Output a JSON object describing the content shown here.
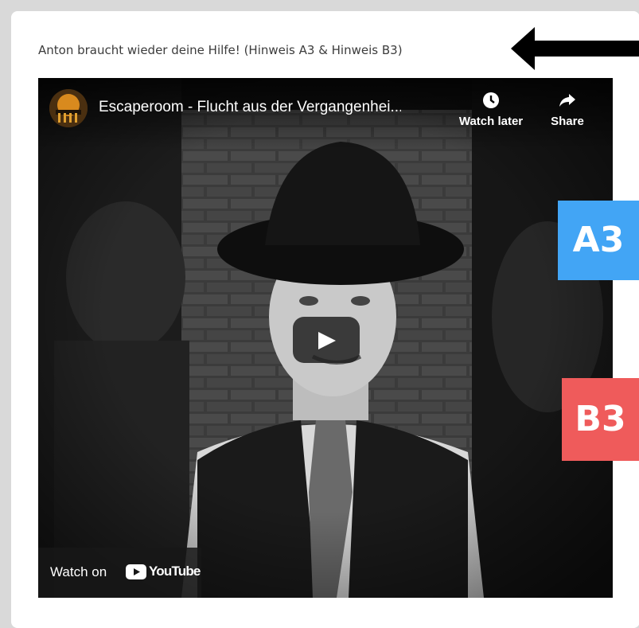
{
  "caption": "Anton braucht wieder deine Hilfe! (Hinweis A3 & Hinweis B3)",
  "video": {
    "title": "Escaperoom - Flucht aus der Vergangenhei...",
    "watch_later_label": "Watch later",
    "share_label": "Share",
    "watch_on_label": "Watch on",
    "youtube_wordmark": "YouTube"
  },
  "badges": {
    "a3": "A3",
    "b3": "B3"
  },
  "colors": {
    "badge_a3": "#42a5f5",
    "badge_b3": "#ef5b5b",
    "youtube_red": "#ff0000"
  },
  "icons": [
    "arrow-left-icon",
    "clock-icon",
    "share-icon",
    "play-icon",
    "youtube-logo-icon"
  ]
}
